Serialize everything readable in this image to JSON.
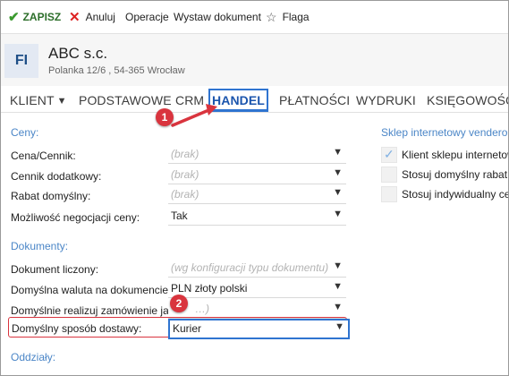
{
  "toolbar": {
    "save_label": "ZAPISZ",
    "cancel_label": "Anuluj",
    "operations_label": "Operacje",
    "issue_document_label": "Wystaw dokument",
    "flag_label": "Flaga"
  },
  "header": {
    "badge": "FI",
    "company_name": "ABC s.c.",
    "address": "Polanka  12/6 , 54-365 Wrocław"
  },
  "tabs": [
    "KLIENT",
    "PODSTAWOWE",
    "CRM",
    "HANDEL",
    "PŁATNOŚCI",
    "WYDRUKI",
    "KSIĘGOWOŚĆ"
  ],
  "active_tab": "HANDEL",
  "prices": {
    "section_title": "Ceny:",
    "fields": [
      {
        "label": "Cena/Cennik:",
        "value": "(brak)"
      },
      {
        "label": "Cennik dodatkowy:",
        "value": "(brak)"
      },
      {
        "label": "Rabat domyślny:",
        "value": "(brak)"
      },
      {
        "label": "Możliwość negocjacji ceny:",
        "value": "Tak"
      }
    ]
  },
  "documents": {
    "section_title": "Dokumenty:",
    "fields": [
      {
        "label": "Dokument liczony:",
        "value": "(wg konfiguracji typu dokumentu)"
      },
      {
        "label": "Domyślna waluta na dokumencie:",
        "value": "PLN  złoty polski"
      },
      {
        "label": "Domyślnie realizuj zamówienie jako:",
        "value": "…)"
      },
      {
        "label": "Domyślny sposób dostawy:",
        "value": "Kurier"
      }
    ]
  },
  "branches": {
    "section_title": "Oddziały:"
  },
  "online_store": {
    "section_title": "Sklep internetowy vendero:",
    "options": [
      {
        "label": "Klient sklepu internetowe",
        "checked": true
      },
      {
        "label": "Stosuj domyślny rabat w",
        "checked": false
      },
      {
        "label": "Stosuj indywidualny cenn",
        "checked": false
      }
    ]
  },
  "callouts": [
    "1",
    "2"
  ],
  "colors": {
    "accent": "#2f74d0",
    "callout": "#d9343e",
    "section": "#4b86c7",
    "save": "#3a9a2e"
  }
}
